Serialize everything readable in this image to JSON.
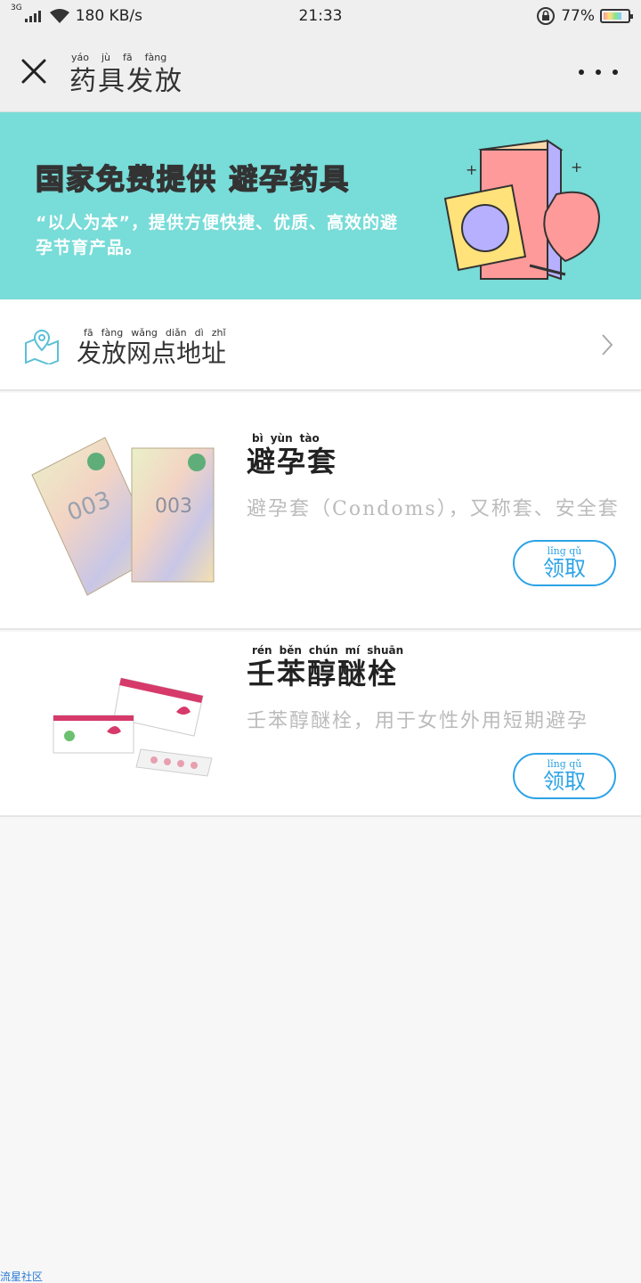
{
  "status_bar": {
    "network_type": "3G",
    "speed": "180 KB/s",
    "time": "21:33",
    "battery": "77%",
    "battery_level": 0.77
  },
  "nav": {
    "title": "药具发放",
    "title_pinyin": [
      "yáo",
      "jù",
      "fā",
      "fàng"
    ]
  },
  "banner": {
    "title_part1": "国家",
    "title_part2": "免费",
    "title_part3": "提供",
    "title_part4": "避孕",
    "title_part5": "药具",
    "description": "“以人为本”，提供方便快捷、优质、高效的避孕节育产品。",
    "colors": {
      "background": "#78dcd8",
      "highlight_yellow": "#ffd54a",
      "highlight_blue": "#b7b0ff"
    }
  },
  "address": {
    "label": "发放网点地址",
    "pinyin": [
      "fā",
      "fàng",
      "wǎng",
      "diǎn",
      "dì",
      "zhǐ"
    ]
  },
  "products": [
    {
      "name": "避孕套",
      "name_pinyin": [
        "bì",
        "yùn",
        "tào"
      ],
      "description": "避孕套（Condoms），又称套、安全套",
      "button": "领取",
      "button_pinyin": "lǐng qǔ",
      "image_text": "003"
    },
    {
      "name": "壬苯醇醚栓",
      "name_pinyin": [
        "rén",
        "běn",
        "chún",
        "mí",
        "shuān"
      ],
      "description": "壬苯醇醚栓，用于女性外用短期避孕",
      "button": "领取",
      "button_pinyin": "lǐng qǔ"
    }
  ],
  "watermark": "流星社区",
  "accent_color": "#2da3e6"
}
